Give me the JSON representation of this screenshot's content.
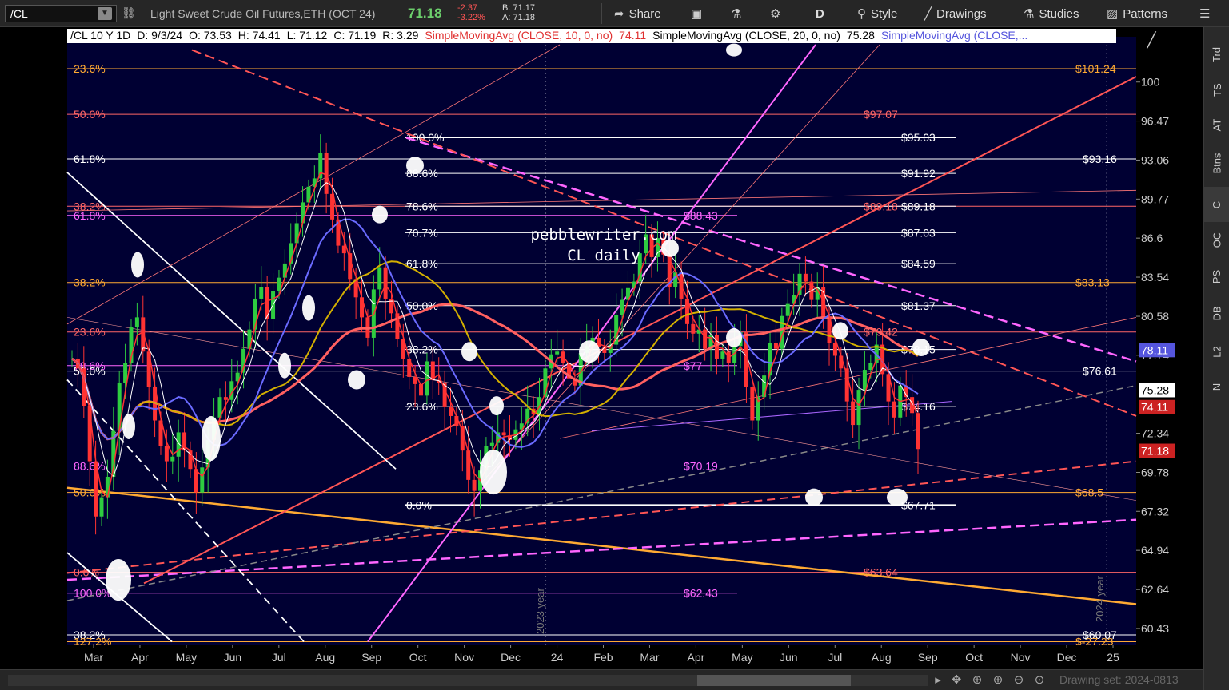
{
  "toolbar": {
    "symbol": "/CL",
    "instrument_title": "Light Sweet Crude Oil Futures,ETH (OCT 24)",
    "last_price": "71.18",
    "net_change": "-2.37",
    "net_change_pct": "-3.22%",
    "bid": "B: 71.17",
    "ask": "A: 71.18",
    "share_label": "Share",
    "aggregation_label": "D",
    "style_label": "Style",
    "drawings_label": "Drawings",
    "studies_label": "Studies",
    "patterns_label": "Patterns"
  },
  "legend": {
    "header": "/CL 10 Y 1D",
    "date": "D: 9/3/24",
    "open": "O: 73.53",
    "high": "H: 74.41",
    "low": "L: 71.12",
    "close": "C: 71.19",
    "range": "R: 3.29",
    "sma10_label": "SimpleMovingAvg (CLOSE, 10, 0, no)",
    "sma10_value": "74.11",
    "sma20_label": "SimpleMovingAvg (CLOSE, 20, 0, no)",
    "sma20_value": "75.28",
    "sma50_label": "SimpleMovingAvg (CLOSE,..."
  },
  "side_tabs": [
    "Trd",
    "TS",
    "AT",
    "Btns",
    "C",
    "OC",
    "PS",
    "DB",
    "L2",
    "N"
  ],
  "bottom": {
    "drawing_set": "Drawing set: 2024-0813"
  },
  "colors": {
    "background": "#000033",
    "up_candle": "#2ecc40",
    "down_candle": "#ff3333",
    "sma10": "#ff3333",
    "sma20": "#ffffff",
    "sma50": "#6a6aff",
    "sma100": "#d4b000",
    "sma200": "#ff6060",
    "fib_orange": "#ffaa33",
    "fib_white": "#ffffff",
    "fib_pink": "#ff66ff"
  },
  "chart_data": {
    "type": "candlestick",
    "title": "pebblewriter.com\nCL daily",
    "title_lines": [
      "pebblewriter.com",
      "CL daily"
    ],
    "ylim": [
      59.5,
      103.5
    ],
    "y_ticks": [
      100,
      96.47,
      93.06,
      89.77,
      86.6,
      83.54,
      80.58,
      77.74,
      72.34,
      69.78,
      67.32,
      64.94,
      62.64,
      60.43
    ],
    "x_ticks": [
      "Mar",
      "Apr",
      "May",
      "Jun",
      "Jul",
      "Aug",
      "Sep",
      "Oct",
      "Nov",
      "Dec",
      "24",
      "Feb",
      "Mar",
      "Apr",
      "May",
      "Jun",
      "Jul",
      "Aug",
      "Sep",
      "Oct",
      "Nov",
      "Dec",
      "25"
    ],
    "x_tick_months_index": [
      0,
      1,
      2,
      3,
      4,
      5,
      6,
      7,
      8,
      9,
      10,
      11,
      12,
      13,
      14,
      15,
      16,
      17,
      18,
      19,
      20,
      21,
      22
    ],
    "year_labels": [
      "2023 year",
      "2024 year"
    ],
    "price_badges": [
      {
        "value": "78.11",
        "color": "#5555dd"
      },
      {
        "value": "75.28",
        "color": "#ffffff"
      },
      {
        "value": "74.11",
        "color": "#cc2222"
      },
      {
        "value": "71.18",
        "color": "#cc2222"
      }
    ],
    "fib_levels_left": [
      {
        "pct": "23.6%",
        "price": 101.24,
        "color": "#ffaa33"
      },
      {
        "pct": "50.0%",
        "price": 97.07,
        "color": "#ff6666"
      },
      {
        "pct": "61.8%",
        "price": 93.16,
        "color": "#ffffff"
      },
      {
        "pct": "38.2%",
        "price": 89.18,
        "color": "#ff6666"
      },
      {
        "pct": "61.8%",
        "price": 88.43,
        "color": "#ff66ff"
      },
      {
        "pct": "38.2%",
        "price": 83.13,
        "color": "#ffaa33"
      },
      {
        "pct": "23.6%",
        "price": 79.42,
        "color": "#ff6666"
      },
      {
        "pct": "78.6%",
        "price": 77,
        "color": "#ff66ff"
      },
      {
        "pct": "50.0%",
        "price": 76.61,
        "color": "#ffffff"
      },
      {
        "pct": "88.6%",
        "price": 70.19,
        "color": "#ff66ff"
      },
      {
        "pct": "50.0%",
        "price": 68.5,
        "color": "#ffaa33"
      },
      {
        "pct": "0.0%",
        "price": 63.64,
        "color": "#ff6666"
      },
      {
        "pct": "100.0%",
        "price": 62.43,
        "color": "#ff66ff"
      },
      {
        "pct": "38.2%",
        "price": 60.07,
        "color": "#ffffff"
      },
      {
        "pct": "127.2%",
        "price": 59.7,
        "color": "#ffaa33"
      }
    ],
    "fib_levels_mid": [
      {
        "pct": "100.0%",
        "price": 95.03
      },
      {
        "pct": "88.6%",
        "price": 91.92
      },
      {
        "pct": "78.6%",
        "price": 89.18
      },
      {
        "pct": "70.7%",
        "price": 87.03
      },
      {
        "pct": "61.8%",
        "price": 84.59
      },
      {
        "pct": "50.0%",
        "price": 81.37
      },
      {
        "pct": "38.2%",
        "price": 78.15
      },
      {
        "pct": "23.6%",
        "price": 74.16
      },
      {
        "pct": "0.0%",
        "price": 67.71
      }
    ],
    "right_labels": [
      {
        "text": "$101.24",
        "price": 101.24,
        "color": "#ffaa33"
      },
      {
        "text": "$97.07",
        "price": 97.07,
        "color": "#ff6666"
      },
      {
        "text": "$95.03",
        "price": 95.03,
        "color": "#ffffff"
      },
      {
        "text": "$93.16",
        "price": 93.16,
        "color": "#ffffff"
      },
      {
        "text": "$91.92",
        "price": 91.92,
        "color": "#ffffff"
      },
      {
        "text": "$89.18",
        "price": 89.18,
        "color": "#ff6666"
      },
      {
        "text": "$89.18",
        "price": 89.18,
        "color": "#ffffff"
      },
      {
        "text": "$88.43",
        "price": 88.43,
        "color": "#ff66ff"
      },
      {
        "text": "$87.03",
        "price": 87.03,
        "color": "#ffffff"
      },
      {
        "text": "$84.59",
        "price": 84.59,
        "color": "#ffffff"
      },
      {
        "text": "$83.13",
        "price": 83.13,
        "color": "#ffaa33"
      },
      {
        "text": "$81.37",
        "price": 81.37,
        "color": "#ffffff"
      },
      {
        "text": "$79.42",
        "price": 79.42,
        "color": "#ff6666"
      },
      {
        "text": "$78.15",
        "price": 78.15,
        "color": "#ffffff"
      },
      {
        "text": "$77",
        "price": 77,
        "color": "#ff66ff"
      },
      {
        "text": "$76.61",
        "price": 76.61,
        "color": "#ffffff"
      },
      {
        "text": "$74.16",
        "price": 74.16,
        "color": "#ffffff"
      },
      {
        "text": "$70.19",
        "price": 70.19,
        "color": "#ff66ff"
      },
      {
        "text": "$68.5",
        "price": 68.5,
        "color": "#ffaa33"
      },
      {
        "text": "$67.71",
        "price": 67.71,
        "color": "#ffffff"
      },
      {
        "text": "$63.64",
        "price": 63.64,
        "color": "#ff6666"
      },
      {
        "text": "$62.43",
        "price": 62.43,
        "color": "#ff66ff"
      },
      {
        "text": "$60.07",
        "price": 60.07,
        "color": "#ffffff"
      },
      {
        "text": "$-27.23",
        "price": 59.7,
        "color": "#ffaa33"
      }
    ],
    "close_series": [
      77.5,
      76.8,
      74.2,
      70.5,
      67.0,
      68.2,
      69.5,
      72.5,
      75.8,
      77.2,
      79.8,
      80.5,
      78.0,
      75.5,
      73.2,
      71.5,
      70.5,
      70.8,
      72.4,
      71.2,
      70.0,
      68.5,
      70.1,
      71.9,
      73.4,
      74.8,
      74.6,
      75.9,
      76.5,
      78.2,
      79.6,
      81.9,
      82.8,
      80.4,
      82.5,
      83.5,
      84.6,
      86.2,
      87.8,
      89.5,
      90.8,
      91.5,
      93.7,
      90.2,
      88.1,
      86.0,
      85.4,
      83.4,
      82.0,
      80.5,
      79.0,
      82.6,
      84.3,
      81.9,
      80.8,
      78.9,
      77.5,
      76.2,
      75.7,
      74.9,
      77.3,
      76.0,
      75.8,
      74.1,
      73.5,
      72.8,
      71.2,
      69.3,
      68.6,
      69.9,
      71.5,
      71.7,
      72.4,
      72.2,
      71.9,
      72.6,
      73.0,
      74.0,
      73.6,
      74.8,
      76.8,
      77.8,
      78.0,
      77.2,
      76.1,
      75.6,
      77.9,
      78.4,
      79.0,
      78.3,
      77.9,
      78.5,
      80.7,
      81.8,
      82.7,
      83.2,
      85.4,
      86.9,
      85.1,
      86.6,
      85.3,
      82.8,
      83.9,
      81.9,
      80.0,
      79.3,
      79.6,
      78.2,
      79.2,
      77.5,
      78.0,
      77.2,
      78.4,
      79.4,
      75.5,
      73.2,
      74.8,
      76.3,
      78.6,
      78.2,
      80.6,
      81.5,
      82.2,
      83.8,
      83.2,
      81.8,
      82.8,
      80.5,
      78.6,
      77.7,
      76.8,
      74.5,
      72.9,
      75.3,
      76.7,
      77.2,
      78.5,
      76.4,
      74.5,
      73.4,
      75.6,
      74.8,
      73.7,
      71.3
    ]
  }
}
